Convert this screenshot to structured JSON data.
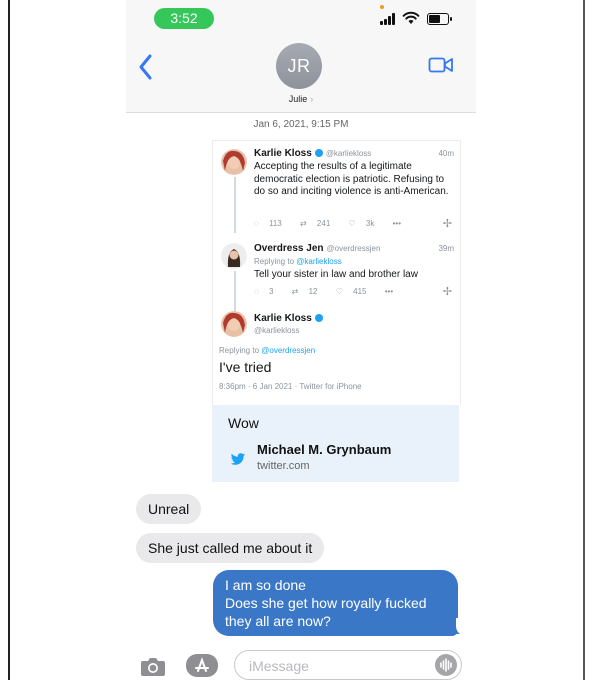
{
  "status_bar": {
    "time": "3:52"
  },
  "contact": {
    "initials": "JR",
    "name": "Julie"
  },
  "thread": {
    "date": "Jan 6, 2021, 9:15 PM"
  },
  "embedded_tweets": {
    "tweet1": {
      "name": "Karlie Kloss",
      "handle": "@karliekloss",
      "age": "40m",
      "text": "Accepting the results of a legitimate democratic election is patriotic. Refusing to do so and inciting violence is anti-American.",
      "replies": "113",
      "retweets": "241",
      "likes": "3k"
    },
    "tweet2": {
      "name": "Overdress Jen",
      "handle": "@overdressjen",
      "age": "39m",
      "replying_prefix": "Replying to",
      "replying_to": "@karliekloss",
      "text": "Tell your sister in law and brother law",
      "replies": "3",
      "retweets": "12",
      "likes": "415"
    },
    "tweet3": {
      "name": "Karlie Kloss",
      "handle": "@karliekloss",
      "replying_prefix": "Replying to",
      "replying_to": "@overdressjen",
      "text": "I've tried",
      "meta": "8:36pm · 6 Jan 2021 · Twitter for iPhone"
    }
  },
  "link_preview": {
    "message": "Wow",
    "title": "Michael M. Grynbaum",
    "domain": "twitter.com"
  },
  "messages": {
    "incoming1": "Unreal",
    "incoming2": "She just called me about it",
    "outgoing": [
      "I am so done",
      "Does she get how royally fucked",
      "they all are now?"
    ]
  },
  "composer": {
    "placeholder": "iMessage"
  },
  "colors": {
    "status_green": "#35c759",
    "ios_blue": "#3a78c7",
    "incoming_bubble": "#e9e9eb",
    "twitter_blue": "#1da1f2"
  }
}
